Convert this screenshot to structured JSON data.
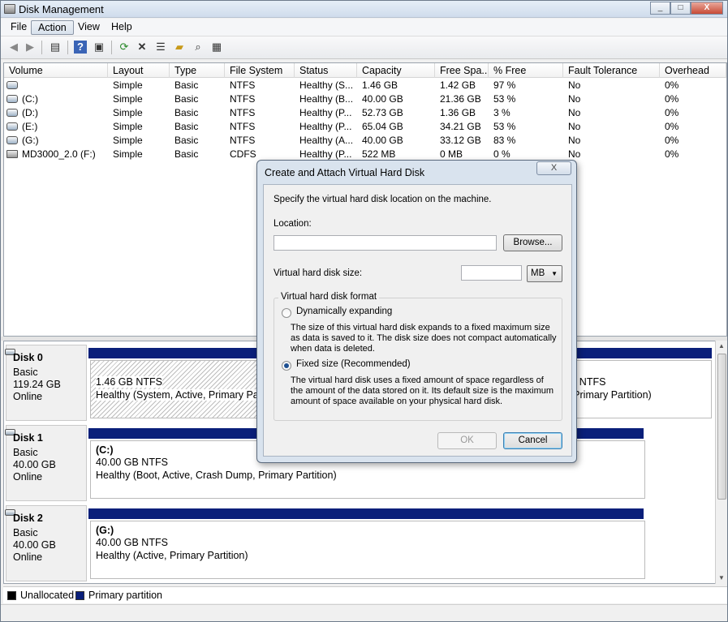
{
  "window": {
    "title": "Disk Management",
    "buttons": [
      "_",
      "□",
      "X"
    ]
  },
  "menu": [
    "File",
    "Action",
    "View",
    "Help"
  ],
  "toolbar_icons": [
    "back-icon",
    "forward-icon",
    "show-hide-console-tree-icon",
    "help-icon",
    "console-icon",
    "refresh-icon",
    "delete-icon",
    "properties-icon",
    "open-icon",
    "explore-icon",
    "wizard-icon"
  ],
  "volumes": {
    "columns": [
      "Volume",
      "Layout",
      "Type",
      "File System",
      "Status",
      "Capacity",
      "Free Spa...",
      "% Free",
      "Fault Tolerance",
      "Overhead"
    ],
    "rows": [
      [
        "",
        "Simple",
        "Basic",
        "NTFS",
        "Healthy (S...",
        "1.46 GB",
        "1.42 GB",
        "97 %",
        "No",
        "0%"
      ],
      [
        "(C:)",
        "Simple",
        "Basic",
        "NTFS",
        "Healthy (B...",
        "40.00 GB",
        "21.36 GB",
        "53 %",
        "No",
        "0%"
      ],
      [
        "(D:)",
        "Simple",
        "Basic",
        "NTFS",
        "Healthy (P...",
        "52.73 GB",
        "1.36 GB",
        "3 %",
        "No",
        "0%"
      ],
      [
        "(E:)",
        "Simple",
        "Basic",
        "NTFS",
        "Healthy (P...",
        "65.04 GB",
        "34.21 GB",
        "53 %",
        "No",
        "0%"
      ],
      [
        "(G:)",
        "Simple",
        "Basic",
        "NTFS",
        "Healthy (A...",
        "40.00 GB",
        "33.12 GB",
        "83 %",
        "No",
        "0%"
      ],
      [
        "MD3000_2.0 (F:)",
        "Simple",
        "Basic",
        "CDFS",
        "Healthy (P...",
        "522 MB",
        "0 MB",
        "0 %",
        "No",
        "0%"
      ]
    ]
  },
  "disks": [
    {
      "name": "Disk 0",
      "type": "Basic",
      "size": "119.24 GB",
      "state": "Online",
      "partitions": [
        {
          "label": "",
          "size": "1.46 GB NTFS",
          "status": "Healthy (System, Active, Primary Partit"
        },
        {
          "label": "",
          "size": "B NTFS",
          "status": "(Primary Partition)"
        }
      ]
    },
    {
      "name": "Disk 1",
      "type": "Basic",
      "size": "40.00 GB",
      "state": "Online",
      "partitions": [
        {
          "label": "(C:)",
          "size": "40.00 GB NTFS",
          "status": "Healthy (Boot, Active, Crash Dump, Primary Partition)"
        }
      ]
    },
    {
      "name": "Disk 2",
      "type": "Basic",
      "size": "40.00 GB",
      "state": "Online",
      "partitions": [
        {
          "label": "(G:)",
          "size": "40.00 GB NTFS",
          "status": "Healthy (Active, Primary Partition)"
        }
      ]
    }
  ],
  "legend": {
    "unallocated": "Unallocated",
    "primary": "Primary partition"
  },
  "colors": {
    "primary": "#0a1f7a",
    "unallocated": "#000000"
  },
  "dialog": {
    "title": "Create and Attach Virtual Hard Disk",
    "close": "X",
    "intro": "Specify the virtual hard disk location on the machine.",
    "location_label": "Location:",
    "location_value": "",
    "browse": "Browse...",
    "size_label": "Virtual hard disk size:",
    "size_value": "",
    "unit": "MB",
    "format_title": "Virtual hard disk format",
    "dynamic_label": "Dynamically expanding",
    "dynamic_desc": "The size of this virtual hard disk expands to a fixed maximum size as data is saved to it.  The disk size does not compact automatically when data is deleted.",
    "fixed_label": "Fixed size (Recommended)",
    "fixed_desc": "The virtual hard disk uses a fixed amount of space regardless of the amount of the data stored on it.  Its default size is the maximum amount of space available on your physical hard disk.",
    "ok": "OK",
    "cancel": "Cancel"
  }
}
